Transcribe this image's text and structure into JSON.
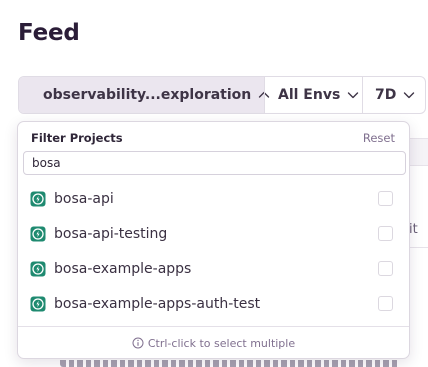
{
  "page": {
    "title": "Feed"
  },
  "filter_bar": {
    "project_label": "observability...exploration",
    "env_label": "All Envs",
    "date_label": "7D"
  },
  "dropdown": {
    "title": "Filter Projects",
    "reset_label": "Reset",
    "search_value": "bosa",
    "items": [
      {
        "label": "bosa-api",
        "checked": false
      },
      {
        "label": "bosa-api-testing",
        "checked": false
      },
      {
        "label": "bosa-example-apps",
        "checked": false
      },
      {
        "label": "bosa-example-apps-auth-test",
        "checked": false
      }
    ],
    "footer_hint": "Ctrl-click to select multiple"
  },
  "background": {
    "partial_text": "it"
  },
  "colors": {
    "platform_icon": "#1f8a70",
    "selector_bg": "#ebe6ef",
    "muted_text": "#80708f"
  },
  "icons": {
    "platform": "lightning-bolt-icon",
    "chevron_up": "chevron-up-icon",
    "chevron_down": "chevron-down-icon",
    "info": "info-circle-icon"
  }
}
